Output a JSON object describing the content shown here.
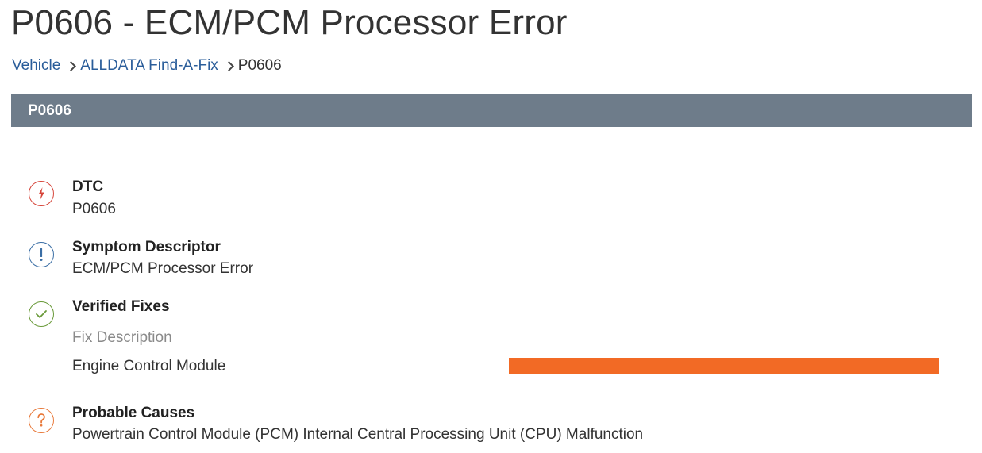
{
  "page": {
    "title": "P0606 - ECM/PCM Processor Error"
  },
  "breadcrumb": {
    "items": [
      "Vehicle",
      "ALLDATA Find-A-Fix"
    ],
    "current": "P0606"
  },
  "section": {
    "header": "P0606"
  },
  "dtc": {
    "icon": "lightning-icon",
    "label": "DTC",
    "value": "P0606"
  },
  "symptom": {
    "icon": "exclamation-icon",
    "label": "Symptom Descriptor",
    "value": "ECM/PCM Processor Error"
  },
  "verified_fixes": {
    "icon": "checkmark-icon",
    "label": "Verified Fixes",
    "column_header": "Fix Description",
    "rows": [
      {
        "description": "Engine Control Module"
      }
    ]
  },
  "probable_causes": {
    "icon": "question-icon",
    "label": "Probable Causes",
    "value": "Powertrain Control Module (PCM) Internal Central Processing Unit (CPU) Malfunction"
  },
  "colors": {
    "dtc_icon": "#d6453a",
    "symptom_icon": "#3a6ea5",
    "verified_icon": "#6a9a3a",
    "probable_icon": "#e8793a",
    "section_bar": "#6e7c8a",
    "fix_bar": "#f26a25",
    "link": "#2a5d9a"
  }
}
